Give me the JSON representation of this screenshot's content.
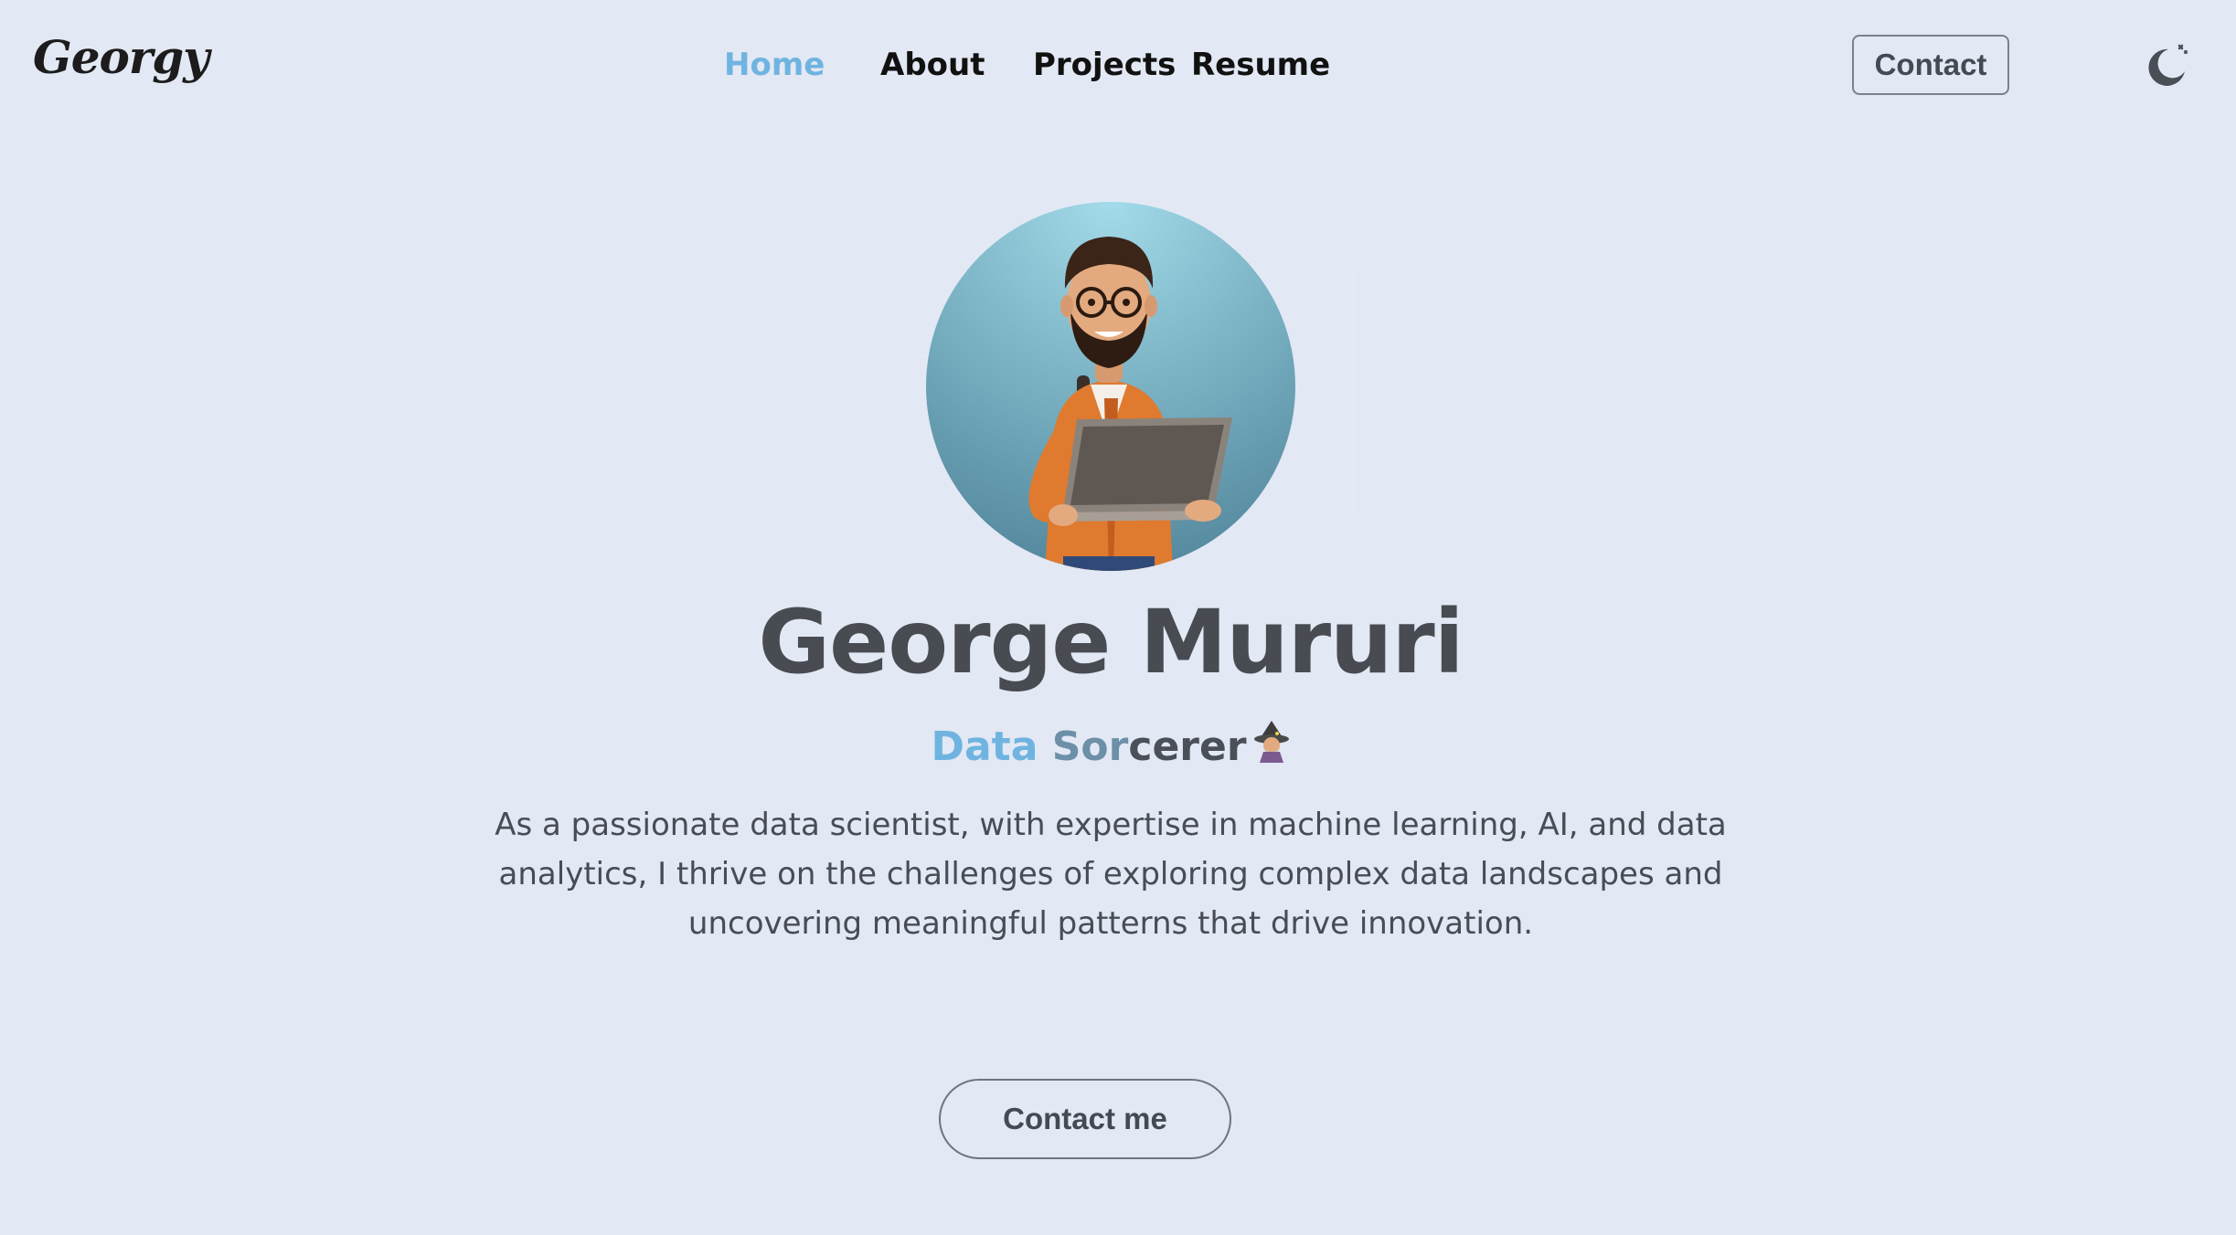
{
  "brand": {
    "logo_text": "Georgy"
  },
  "nav": {
    "items": [
      {
        "label": "Home",
        "active": true
      },
      {
        "label": "About",
        "active": false
      },
      {
        "label": "Projects",
        "active": false
      },
      {
        "label": "Resume",
        "active": false
      }
    ],
    "contact_label": "Contact",
    "theme_toggle_icon": "moon-icon"
  },
  "hero": {
    "avatar_icon": "developer-avatar-illustration",
    "name": "George Mururi",
    "role_part1": "Data ",
    "role_part2": "Sor",
    "role_part3": "cerer",
    "role_emoji_icon": "wizard-icon",
    "description": "As a passionate data scientist, with expertise in machine learning, AI, and data analytics, I thrive on the challenges of exploring complex data landscapes and uncovering meaningful patterns that drive innovation.",
    "cta_label": "Contact me"
  },
  "colors": {
    "background": "#e2e8f4",
    "accent": "#6fb4e0",
    "text": "#484c52"
  }
}
